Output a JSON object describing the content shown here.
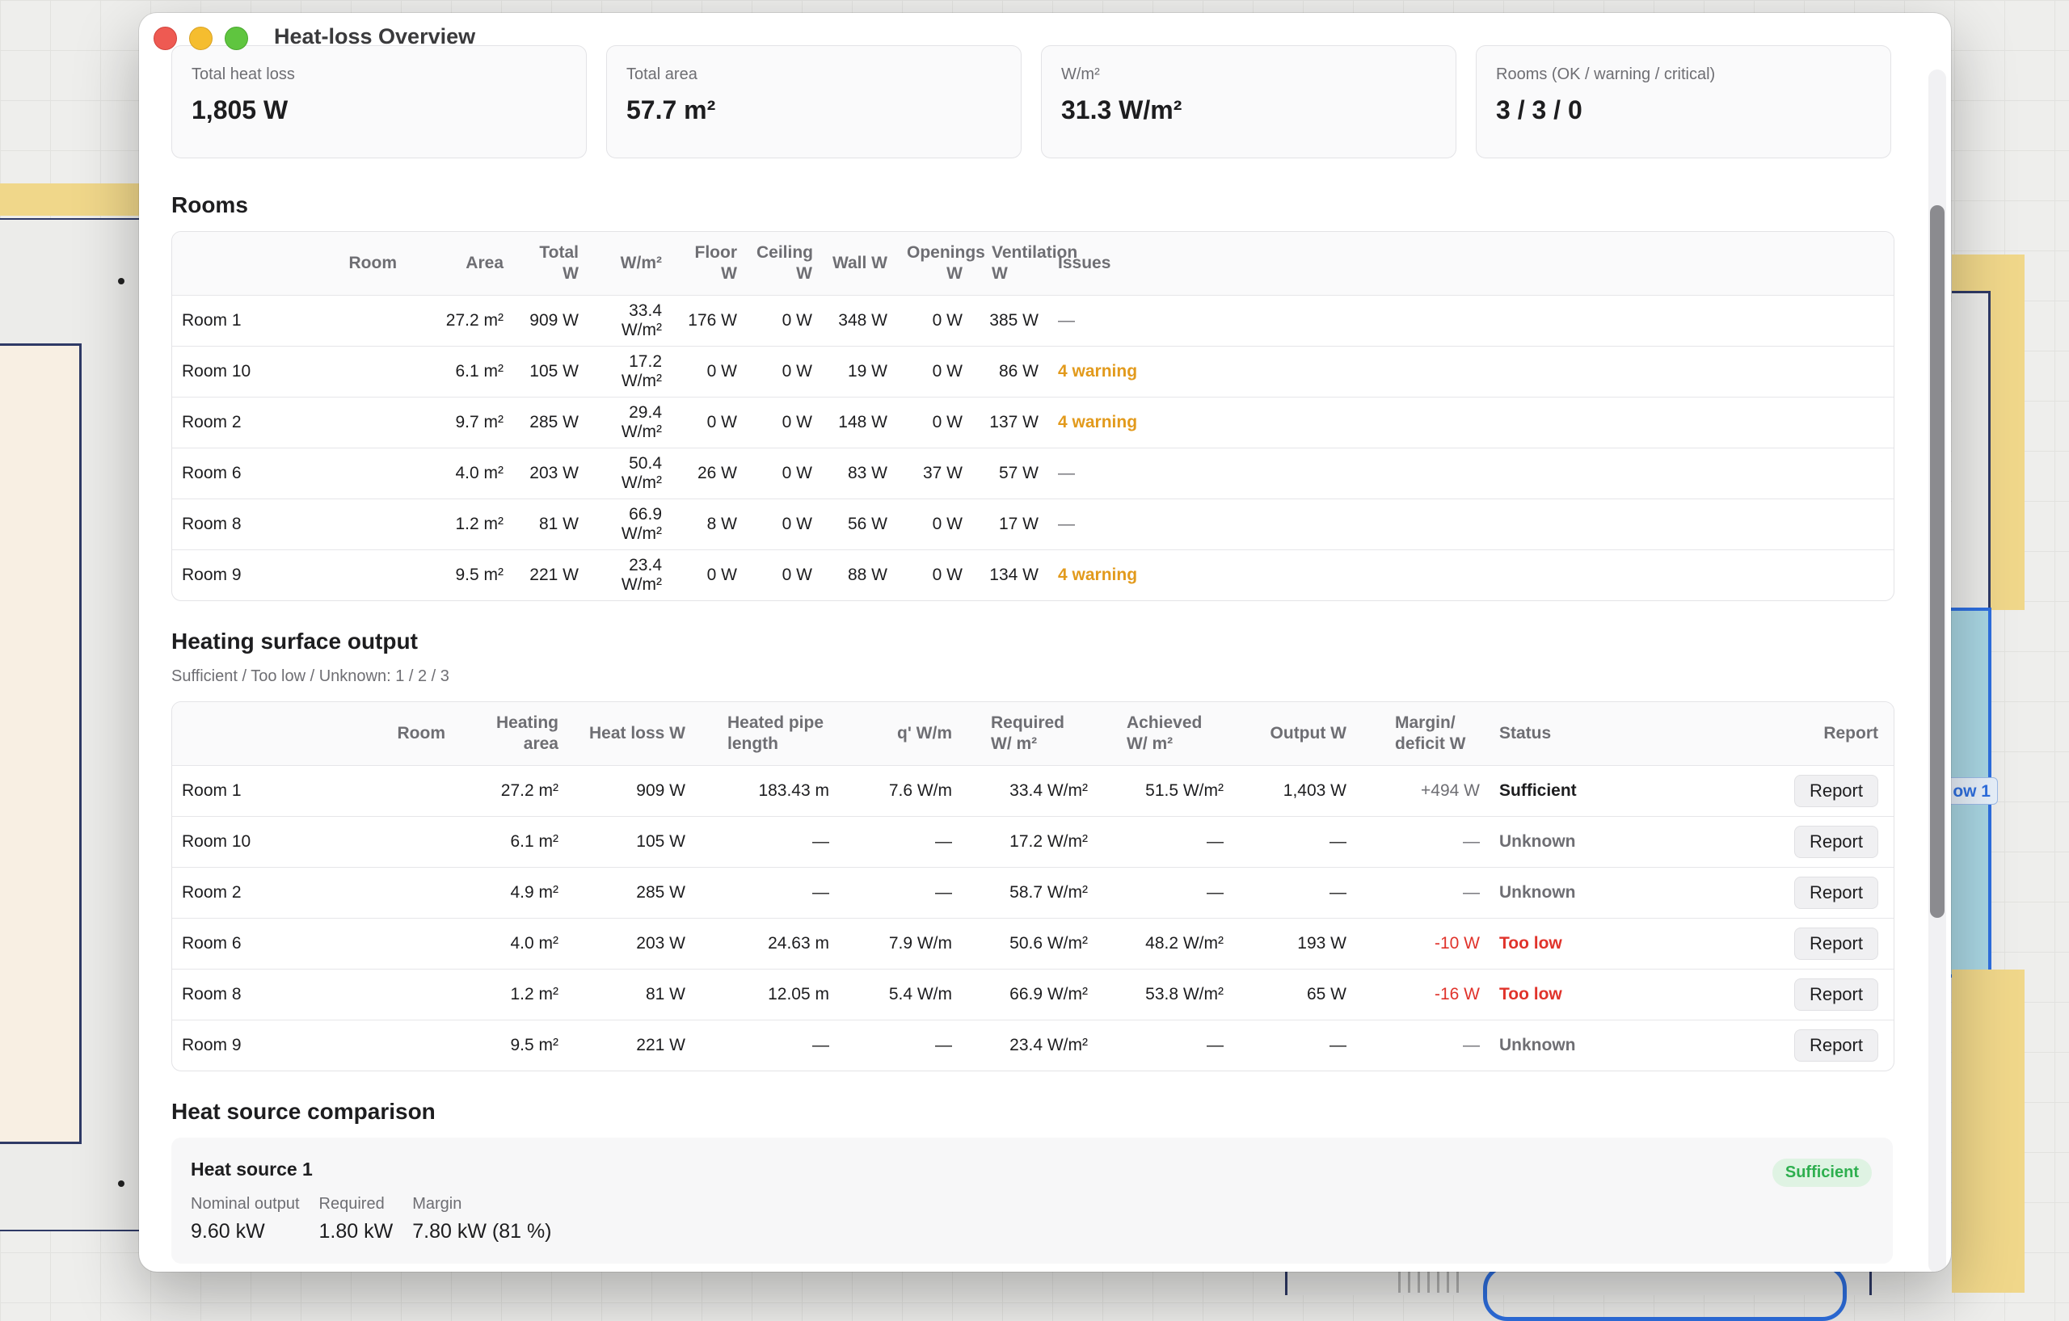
{
  "window": {
    "title": "Heat-loss Overview"
  },
  "background": {
    "tag_label": "ow 1"
  },
  "summary": [
    {
      "label": "Total heat loss",
      "value": "1,805 W"
    },
    {
      "label": "Total area",
      "value": "57.7 m²"
    },
    {
      "label": "W/m²",
      "value": "31.3 W/m²"
    },
    {
      "label": "Rooms (OK / warning / critical)",
      "value": "3 / 3 / 0"
    }
  ],
  "rooms": {
    "title": "Rooms",
    "headers": [
      "Room",
      "Area",
      "Total W",
      "W/m²",
      "Floor W",
      "Ceiling W",
      "Wall W",
      "Openings W",
      "Ventilation W",
      "Issues"
    ],
    "rows": [
      {
        "room": "Room 1",
        "area": "27.2 m²",
        "total": "909 W",
        "wm2": "33.4 W/m²",
        "floor": "176 W",
        "ceiling": "0 W",
        "wall": "348 W",
        "openings": "0 W",
        "vent": "385 W",
        "issues": "—"
      },
      {
        "room": "Room 10",
        "area": "6.1 m²",
        "total": "105 W",
        "wm2": "17.2 W/m²",
        "floor": "0 W",
        "ceiling": "0 W",
        "wall": "19 W",
        "openings": "0 W",
        "vent": "86 W",
        "issues": "4 warning"
      },
      {
        "room": "Room 2",
        "area": "9.7 m²",
        "total": "285 W",
        "wm2": "29.4 W/m²",
        "floor": "0 W",
        "ceiling": "0 W",
        "wall": "148 W",
        "openings": "0 W",
        "vent": "137 W",
        "issues": "4 warning"
      },
      {
        "room": "Room 6",
        "area": "4.0 m²",
        "total": "203 W",
        "wm2": "50.4 W/m²",
        "floor": "26 W",
        "ceiling": "0 W",
        "wall": "83 W",
        "openings": "37 W",
        "vent": "57 W",
        "issues": "—"
      },
      {
        "room": "Room 8",
        "area": "1.2 m²",
        "total": "81 W",
        "wm2": "66.9 W/m²",
        "floor": "8 W",
        "ceiling": "0 W",
        "wall": "56 W",
        "openings": "0 W",
        "vent": "17 W",
        "issues": "—"
      },
      {
        "room": "Room 9",
        "area": "9.5 m²",
        "total": "221 W",
        "wm2": "23.4 W/m²",
        "floor": "0 W",
        "ceiling": "0 W",
        "wall": "88 W",
        "openings": "0 W",
        "vent": "134 W",
        "issues": "4 warning"
      }
    ]
  },
  "heating": {
    "title": "Heating surface output",
    "subtitle": "Sufficient / Too low / Unknown: 1 / 2 / 3",
    "headers": [
      "Room",
      "Heating area",
      "Heat loss W",
      "Heated pipe length",
      "q' W/m",
      "Required W/ m²",
      "Achieved W/ m²",
      "Output W",
      "Margin/ deficit W",
      "Status",
      "Report"
    ],
    "rows": [
      {
        "room": "Room 1",
        "area": "27.2 m²",
        "loss": "909 W",
        "pipe": "183.43 m",
        "q": "7.6 W/m",
        "req": "33.4 W/m²",
        "ach": "51.5 W/m²",
        "out": "1,403 W",
        "margin": "+494 W",
        "status": "Sufficient",
        "report": "Report"
      },
      {
        "room": "Room 10",
        "area": "6.1 m²",
        "loss": "105 W",
        "pipe": "—",
        "q": "—",
        "req": "17.2 W/m²",
        "ach": "—",
        "out": "—",
        "margin": "—",
        "status": "Unknown",
        "report": "Report"
      },
      {
        "room": "Room 2",
        "area": "4.9 m²",
        "loss": "285 W",
        "pipe": "—",
        "q": "—",
        "req": "58.7 W/m²",
        "ach": "—",
        "out": "—",
        "margin": "—",
        "status": "Unknown",
        "report": "Report"
      },
      {
        "room": "Room 6",
        "area": "4.0 m²",
        "loss": "203 W",
        "pipe": "24.63 m",
        "q": "7.9 W/m",
        "req": "50.6 W/m²",
        "ach": "48.2 W/m²",
        "out": "193 W",
        "margin": "-10 W",
        "status": "Too low",
        "report": "Report"
      },
      {
        "room": "Room 8",
        "area": "1.2 m²",
        "loss": "81 W",
        "pipe": "12.05 m",
        "q": "5.4 W/m",
        "req": "66.9 W/m²",
        "ach": "53.8 W/m²",
        "out": "65 W",
        "margin": "-16 W",
        "status": "Too low",
        "report": "Report"
      },
      {
        "room": "Room 9",
        "area": "9.5 m²",
        "loss": "221 W",
        "pipe": "—",
        "q": "—",
        "req": "23.4 W/m²",
        "ach": "—",
        "out": "—",
        "margin": "—",
        "status": "Unknown",
        "report": "Report"
      }
    ]
  },
  "heat_source": {
    "title": "Heat source comparison",
    "name": "Heat source 1",
    "badge": "Sufficient",
    "cols": [
      {
        "label": "Nominal output",
        "value": "9.60 kW"
      },
      {
        "label": "Required",
        "value": "1.80 kW"
      },
      {
        "label": "Margin",
        "value": "7.80 kW (81 %)"
      }
    ]
  },
  "colors": {
    "warning": "#e29a1c",
    "danger": "#e0332b",
    "success": "#2eaf4f",
    "accent": "#2e6fe0"
  }
}
